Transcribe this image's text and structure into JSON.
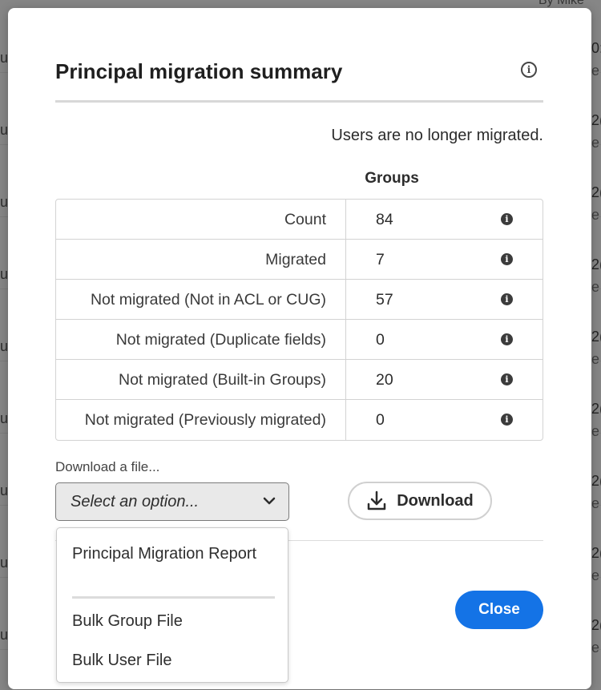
{
  "background": {
    "top_text": "By  Mike",
    "rows": [
      {
        "left": "u",
        "right_a": "0:",
        "right_b": "e"
      },
      {
        "left": "u",
        "right_a": "2(",
        "right_b": "e"
      },
      {
        "left": "u",
        "right_a": "2(",
        "right_b": "e"
      },
      {
        "left": "u",
        "right_a": "2(",
        "right_b": "e"
      },
      {
        "left": "u",
        "right_a": "2(",
        "right_b": "e"
      },
      {
        "left": "u",
        "right_a": "2(",
        "right_b": "e"
      },
      {
        "left": "u",
        "right_a": "2(",
        "right_b": "e"
      },
      {
        "left": "u",
        "right_a": "2(",
        "right_b": "e"
      },
      {
        "left": "u",
        "right_a": "2(",
        "right_b": "e"
      }
    ]
  },
  "dialog": {
    "title": "Principal migration summary",
    "note": "Users are no longer migrated.",
    "column_header": "Groups",
    "rows": [
      {
        "label": "Count",
        "value": "84"
      },
      {
        "label": "Migrated",
        "value": "7"
      },
      {
        "label": "Not migrated (Not in ACL or CUG)",
        "value": "57"
      },
      {
        "label": "Not migrated (Duplicate fields)",
        "value": "0"
      },
      {
        "label": "Not migrated (Built-in Groups)",
        "value": "20"
      },
      {
        "label": "Not migrated (Previously migrated)",
        "value": "0"
      }
    ],
    "download_label": "Download a file...",
    "select_placeholder": "Select an option...",
    "download_button": "Download",
    "close_button": "Close",
    "menu_items": [
      "Principal Migration Report",
      "Bulk Group File",
      "Bulk User File"
    ]
  },
  "colors": {
    "accent": "#1473e6",
    "scrim": "rgba(0,0,0,0.45)"
  }
}
